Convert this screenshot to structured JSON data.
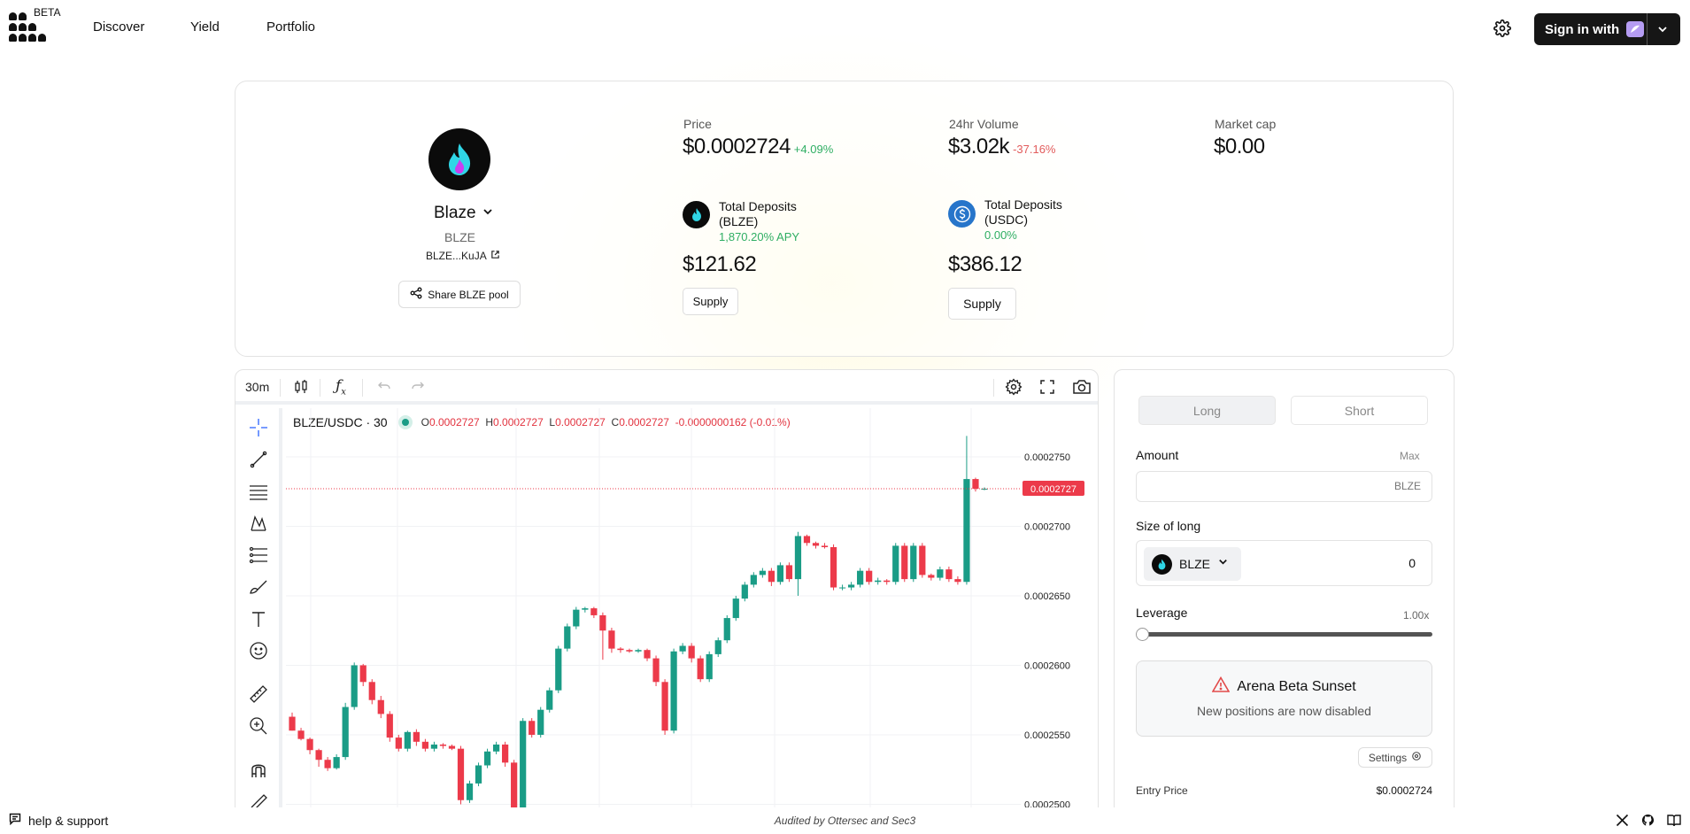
{
  "header": {
    "beta": "BETA",
    "nav": [
      "Discover",
      "Yield",
      "Portfolio"
    ],
    "signin_label": "Sign in with"
  },
  "token": {
    "name": "Blaze",
    "symbol": "BLZE",
    "address": "BLZE...KuJA",
    "share_label": "Share BLZE pool"
  },
  "stats": {
    "price_label": "Price",
    "price": "$0.0002724",
    "price_change": "+4.09%",
    "volume_label": "24hr Volume",
    "volume": "$3.02k",
    "volume_change": "-37.16%",
    "mcap_label": "Market cap",
    "mcap": "$0.00"
  },
  "deposits": [
    {
      "title_line1": "Total Deposits",
      "title_line2": "(BLZE)",
      "apy": "1,870.20% APY",
      "value": "$121.62",
      "supply_label": "Supply"
    },
    {
      "title_line1": "Total Deposits",
      "title_line2": "(USDC)",
      "apy": "0.00%",
      "value": "$386.12",
      "supply_label": "Supply"
    }
  ],
  "chart_toolbar": {
    "interval": "30m"
  },
  "chart_legend": {
    "pair": "BLZE/USDC · 30",
    "o_label": "O",
    "o": "0.0002727",
    "h_label": "H",
    "h": "0.0002727",
    "l_label": "L",
    "l": "0.0002727",
    "c_label": "C",
    "c": "0.0002727",
    "change": "-0.0000000162 (-0.01%)"
  },
  "chart_data": {
    "type": "candlestick",
    "y_ticks": [
      0.000275,
      0.00027,
      0.000265,
      0.00026,
      0.000255,
      0.00025
    ],
    "y_tick_labels": [
      "0.0002750",
      "0.0002700",
      "0.0002650",
      "0.0002600",
      "0.0002550",
      "0.0002500"
    ],
    "last_price": 0.0002727,
    "last_price_label": "0.0002727",
    "ylim": [
      0.0002478,
      0.0002785
    ],
    "up_color": "#1a9c86",
    "down_color": "#ec3a4a",
    "candles": [
      [
        2.563,
        2.553,
        2.566,
        2.553
      ],
      [
        2.553,
        2.547,
        2.555,
        2.546
      ],
      [
        2.547,
        2.539,
        2.548,
        2.536
      ],
      [
        2.539,
        2.532,
        2.54,
        2.527
      ],
      [
        2.532,
        2.526,
        2.534,
        2.524
      ],
      [
        2.526,
        2.534,
        2.536,
        2.525
      ],
      [
        2.534,
        2.57,
        2.573,
        2.532
      ],
      [
        2.57,
        2.6,
        2.602,
        2.568
      ],
      [
        2.6,
        2.588,
        2.601,
        2.585
      ],
      [
        2.588,
        2.575,
        2.59,
        2.572
      ],
      [
        2.575,
        2.565,
        2.578,
        2.562
      ],
      [
        2.565,
        2.548,
        2.567,
        2.545
      ],
      [
        2.548,
        2.54,
        2.55,
        2.538
      ],
      [
        2.54,
        2.552,
        2.553,
        2.538
      ],
      [
        2.552,
        2.545,
        2.554,
        2.542
      ],
      [
        2.545,
        2.54,
        2.547,
        2.538
      ],
      [
        2.54,
        2.543,
        2.545,
        2.538
      ],
      [
        2.543,
        2.542,
        2.544,
        2.54
      ],
      [
        2.542,
        2.54,
        2.543,
        2.539
      ],
      [
        2.54,
        2.503,
        2.542,
        2.5
      ],
      [
        2.503,
        2.515,
        2.517,
        2.501
      ],
      [
        2.515,
        2.528,
        2.53,
        2.513
      ],
      [
        2.528,
        2.538,
        2.54,
        2.526
      ],
      [
        2.538,
        2.543,
        2.545,
        2.536
      ],
      [
        2.543,
        2.53,
        2.545,
        2.527
      ],
      [
        2.53,
        2.485,
        2.532,
        2.48
      ],
      [
        2.485,
        2.56,
        2.562,
        2.483
      ],
      [
        2.56,
        2.55,
        2.562,
        2.548
      ],
      [
        2.55,
        2.568,
        2.57,
        2.548
      ],
      [
        2.568,
        2.582,
        2.584,
        2.566
      ],
      [
        2.582,
        2.612,
        2.614,
        2.58
      ],
      [
        2.612,
        2.628,
        2.63,
        2.61
      ],
      [
        2.628,
        2.64,
        2.642,
        2.626
      ],
      [
        2.64,
        2.641,
        2.642,
        2.638
      ],
      [
        2.641,
        2.636,
        2.642,
        2.634
      ],
      [
        2.636,
        2.625,
        2.638,
        2.604
      ],
      [
        2.625,
        2.612,
        2.627,
        2.609
      ],
      [
        2.612,
        2.611,
        2.613,
        2.609
      ],
      [
        2.611,
        2.61,
        2.612,
        2.609
      ],
      [
        2.61,
        2.611,
        2.612,
        2.609
      ],
      [
        2.611,
        2.605,
        2.612,
        2.603
      ],
      [
        2.605,
        2.588,
        2.607,
        2.585
      ],
      [
        2.588,
        2.553,
        2.59,
        2.55
      ],
      [
        2.553,
        2.61,
        2.612,
        2.551
      ],
      [
        2.61,
        2.614,
        2.616,
        2.608
      ],
      [
        2.614,
        2.605,
        2.616,
        2.602
      ],
      [
        2.605,
        2.59,
        2.607,
        2.588
      ],
      [
        2.59,
        2.608,
        2.61,
        2.588
      ],
      [
        2.608,
        2.618,
        2.62,
        2.606
      ],
      [
        2.618,
        2.634,
        2.636,
        2.616
      ],
      [
        2.634,
        2.648,
        2.65,
        2.632
      ],
      [
        2.648,
        2.658,
        2.66,
        2.646
      ],
      [
        2.658,
        2.665,
        2.667,
        2.656
      ],
      [
        2.665,
        2.668,
        2.67,
        2.663
      ],
      [
        2.668,
        2.66,
        2.67,
        2.657
      ],
      [
        2.66,
        2.672,
        2.674,
        2.658
      ],
      [
        2.672,
        2.662,
        2.674,
        2.66
      ],
      [
        2.662,
        2.693,
        2.696,
        2.65
      ],
      [
        2.693,
        2.688,
        2.694,
        2.686
      ],
      [
        2.688,
        2.686,
        2.689,
        2.684
      ],
      [
        2.686,
        2.685,
        2.688,
        2.684
      ],
      [
        2.685,
        2.656,
        2.687,
        2.654
      ],
      [
        2.656,
        2.656,
        2.658,
        2.654
      ],
      [
        2.656,
        2.658,
        2.66,
        2.654
      ],
      [
        2.658,
        2.668,
        2.67,
        2.656
      ],
      [
        2.668,
        2.66,
        2.67,
        2.658
      ],
      [
        2.66,
        2.661,
        2.663,
        2.658
      ],
      [
        2.661,
        2.66,
        2.662,
        2.658
      ],
      [
        2.66,
        2.686,
        2.688,
        2.658
      ],
      [
        2.686,
        2.662,
        2.688,
        2.66
      ],
      [
        2.662,
        2.686,
        2.688,
        2.66
      ],
      [
        2.686,
        2.665,
        2.688,
        2.663
      ],
      [
        2.665,
        2.663,
        2.666,
        2.661
      ],
      [
        2.663,
        2.669,
        2.671,
        2.661
      ],
      [
        2.669,
        2.662,
        2.671,
        2.66
      ],
      [
        2.662,
        2.66,
        2.664,
        2.658
      ],
      [
        2.66,
        2.734,
        2.765,
        2.658
      ],
      [
        2.734,
        2.727,
        2.735,
        2.725
      ],
      [
        2.727,
        2.727,
        2.728,
        2.726
      ]
    ]
  },
  "trade": {
    "long_label": "Long",
    "short_label": "Short",
    "amount_label": "Amount",
    "max_label": "Max",
    "amount_unit": "BLZE",
    "size_label": "Size of long",
    "size_token": "BLZE",
    "size_value": "0",
    "leverage_label": "Leverage",
    "leverage_value": "1.00x",
    "leverage_fraction": 0.0,
    "sunset_title": "Arena Beta Sunset",
    "sunset_text": "New positions are now disabled",
    "settings_label": "Settings",
    "entry_label": "Entry Price",
    "entry_value": "$0.0002724"
  },
  "footer": {
    "help": "help & support",
    "audited": "Audited by Ottersec and Sec3"
  }
}
